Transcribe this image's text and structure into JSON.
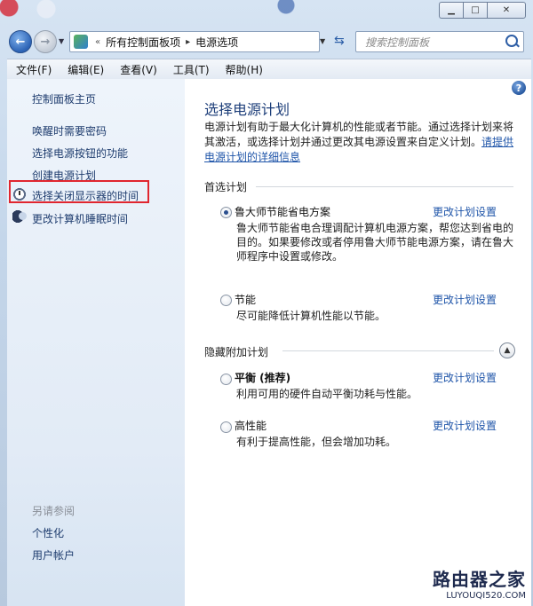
{
  "address": {
    "breadcrumbs": [
      "所有控制面板项",
      "电源选项"
    ],
    "overflow_marker": "«"
  },
  "search": {
    "placeholder": "搜索控制面板"
  },
  "menubar": {
    "items": [
      "文件(F)",
      "编辑(E)",
      "查看(V)",
      "工具(T)",
      "帮助(H)"
    ]
  },
  "sidebar": {
    "home": "控制面板主页",
    "links": [
      "唤醒时需要密码",
      "选择电源按钮的功能",
      "创建电源计划",
      "选择关闭显示器的时间",
      "更改计算机睡眠时间"
    ],
    "see_also": "另请参阅",
    "see_also_links": [
      "个性化",
      "用户帐户"
    ]
  },
  "main": {
    "title": "选择电源计划",
    "intro": "电源计划有助于最大化计算机的性能或者节能。通过选择计划来将其激活，或选择计划并通过更改其电源设置来自定义计划。",
    "intro_link": "请提供电源计划的详细信息",
    "preferred_header": "首选计划",
    "hidden_header": "隐藏附加计划",
    "change_link": "更改计划设置",
    "plans": [
      {
        "name": "鲁大师节能省电方案",
        "selected": true,
        "desc": "鲁大师节能省电合理调配计算机电源方案，帮您达到省电的目的。如果要修改或者停用鲁大师节能电源方案，请在鲁大师程序中设置或修改。"
      },
      {
        "name": "节能",
        "selected": false,
        "desc": "尽可能降低计算机性能以节能。"
      },
      {
        "name": "平衡 (推荐)",
        "selected": false,
        "desc": "利用可用的硬件自动平衡功耗与性能。"
      },
      {
        "name": "高性能",
        "selected": false,
        "desc": "有利于提高性能，但会增加功耗。"
      }
    ]
  },
  "watermark": {
    "main": "路由器之家",
    "url": "LUYOUQI520.COM"
  },
  "colors": {
    "highlight": "#e0262f",
    "link": "#1f55a9",
    "title": "#1e3f7a"
  }
}
